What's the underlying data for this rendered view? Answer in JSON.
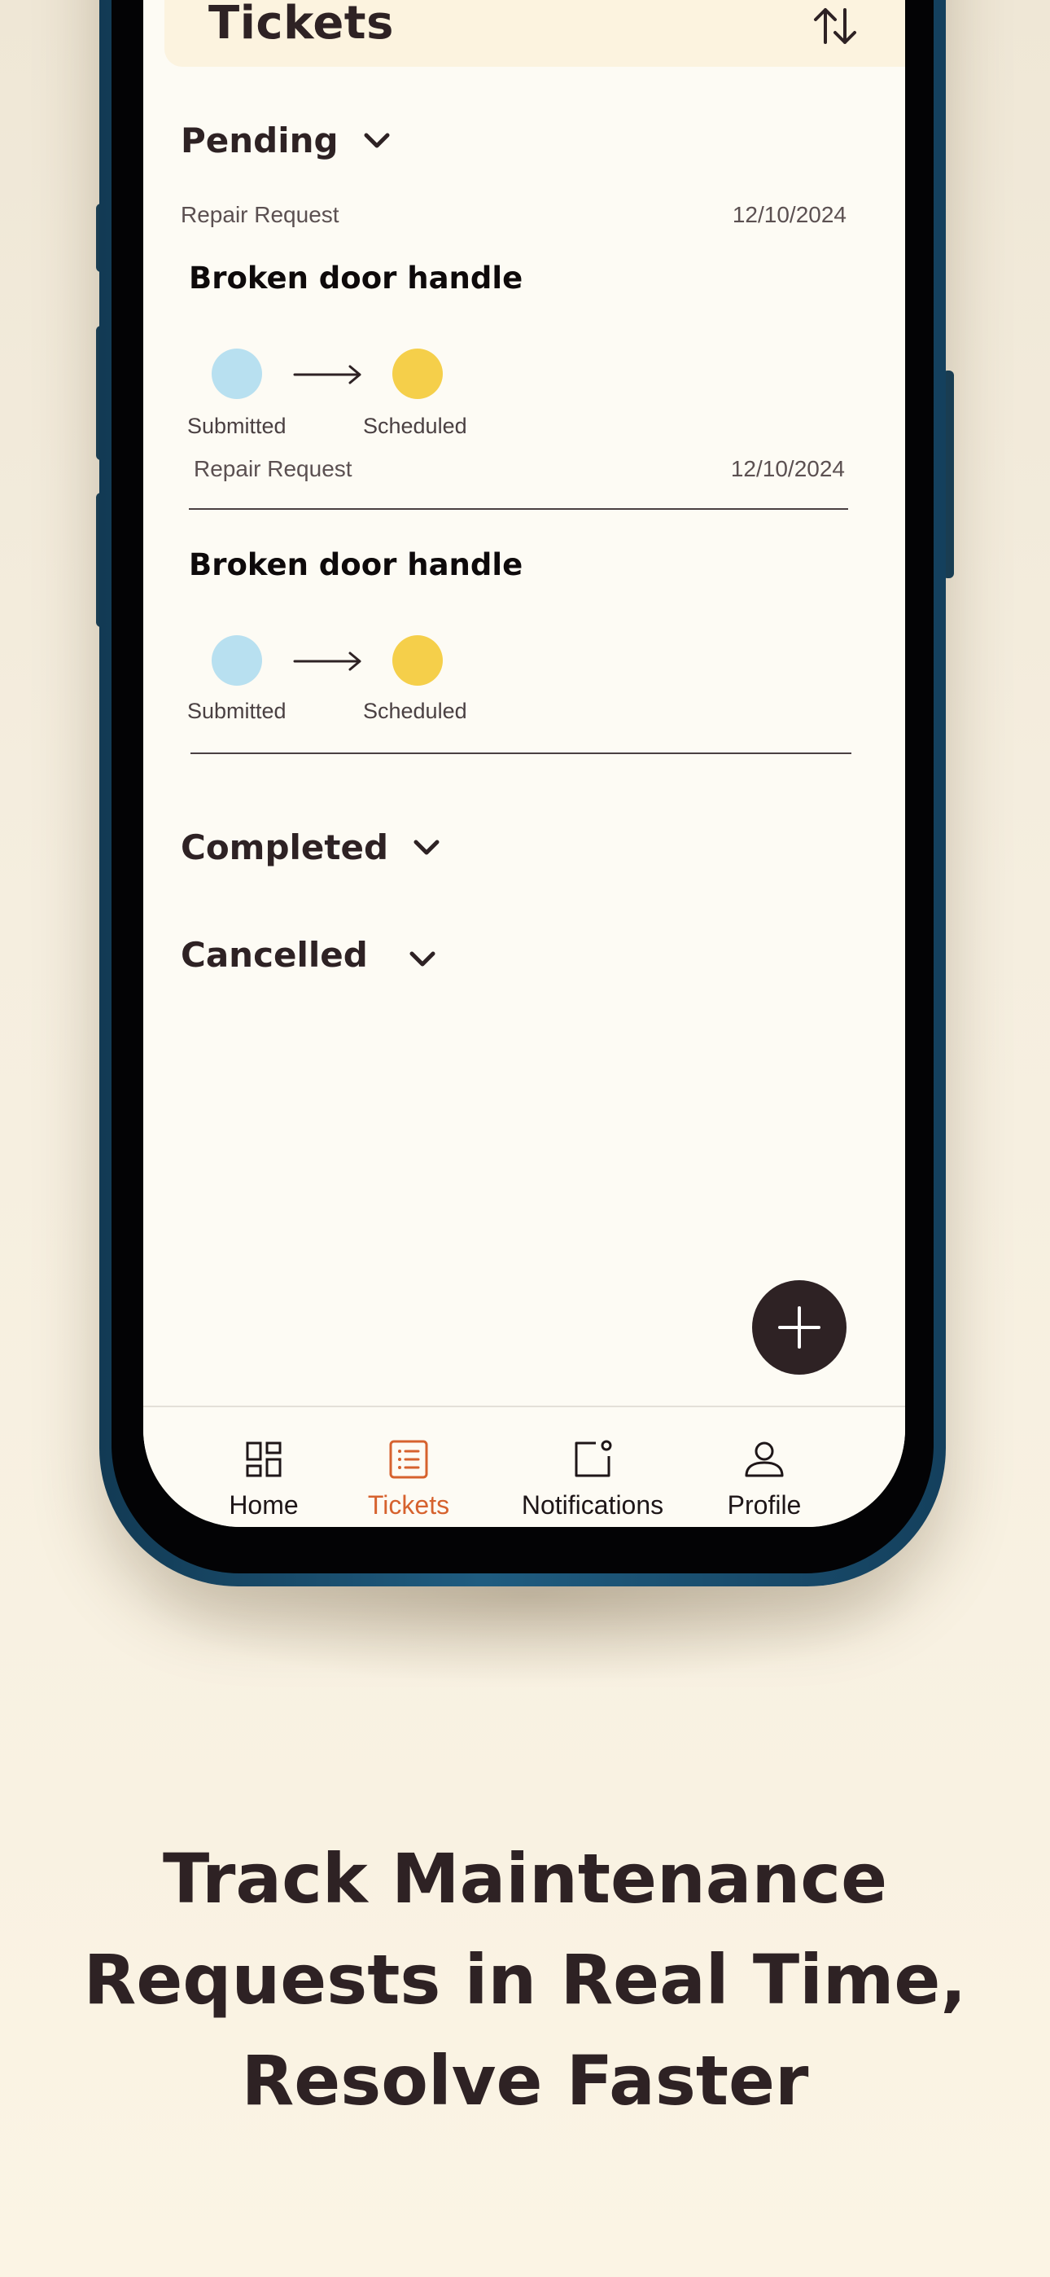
{
  "header": {
    "title": "Tickets"
  },
  "sections": {
    "pending": {
      "label": "Pending"
    },
    "completed": {
      "label": "Completed"
    },
    "cancelled": {
      "label": "Cancelled"
    }
  },
  "tickets": [
    {
      "category": "Repair Request",
      "date": "12/10/2024",
      "title": "Broken door handle",
      "steps": [
        "Submitted",
        "Scheduled"
      ]
    },
    {
      "category": "Repair Request",
      "date": "12/10/2024",
      "title": "Broken door handle",
      "steps": [
        "Submitted",
        "Scheduled"
      ]
    }
  ],
  "nav": [
    {
      "label": "Home",
      "icon": "home-grid-icon"
    },
    {
      "label": "Tickets",
      "icon": "tickets-list-icon",
      "active": true
    },
    {
      "label": "Notifications",
      "icon": "notifications-icon"
    },
    {
      "label": "Profile",
      "icon": "profile-icon"
    }
  ],
  "colors": {
    "accent": "#d6622e",
    "submitted_dot": "#b8e0f0",
    "scheduled_dot": "#f5cf4a",
    "dark": "#2e2224",
    "phone_frame": "#1f5c80"
  },
  "tagline": {
    "line1": "Track Maintenance",
    "line2": "Requests in Real Time,",
    "line3": "Resolve Faster"
  }
}
